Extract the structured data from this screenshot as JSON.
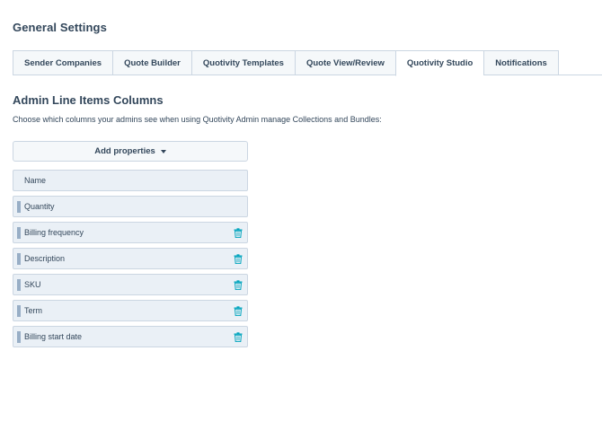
{
  "page": {
    "title": "General Settings"
  },
  "tabs": [
    {
      "label": "Sender Companies",
      "active": false
    },
    {
      "label": "Quote Builder",
      "active": false
    },
    {
      "label": "Quotivity Templates",
      "active": false
    },
    {
      "label": "Quote View/Review",
      "active": false
    },
    {
      "label": "Quotivity Studio",
      "active": true
    },
    {
      "label": "Notifications",
      "active": false
    }
  ],
  "section": {
    "title": "Admin Line Items Columns",
    "description": "Choose which columns your admins see when using Quotivity Admin manage Collections and Bundles:"
  },
  "add_properties": {
    "label": "Add properties",
    "icon": "caret-down-icon"
  },
  "columns": [
    {
      "label": "Name",
      "draggable": false,
      "removable": false
    },
    {
      "label": "Quantity",
      "draggable": true,
      "removable": false
    },
    {
      "label": "Billing frequency",
      "draggable": true,
      "removable": true
    },
    {
      "label": "Description",
      "draggable": true,
      "removable": true
    },
    {
      "label": "SKU",
      "draggable": true,
      "removable": true
    },
    {
      "label": "Term",
      "draggable": true,
      "removable": true
    },
    {
      "label": "Billing start date",
      "draggable": true,
      "removable": true
    }
  ],
  "colors": {
    "text": "#33475b",
    "border": "#cbd6e2",
    "row_bg": "#eaf0f6",
    "trash": "#00a4bd"
  }
}
